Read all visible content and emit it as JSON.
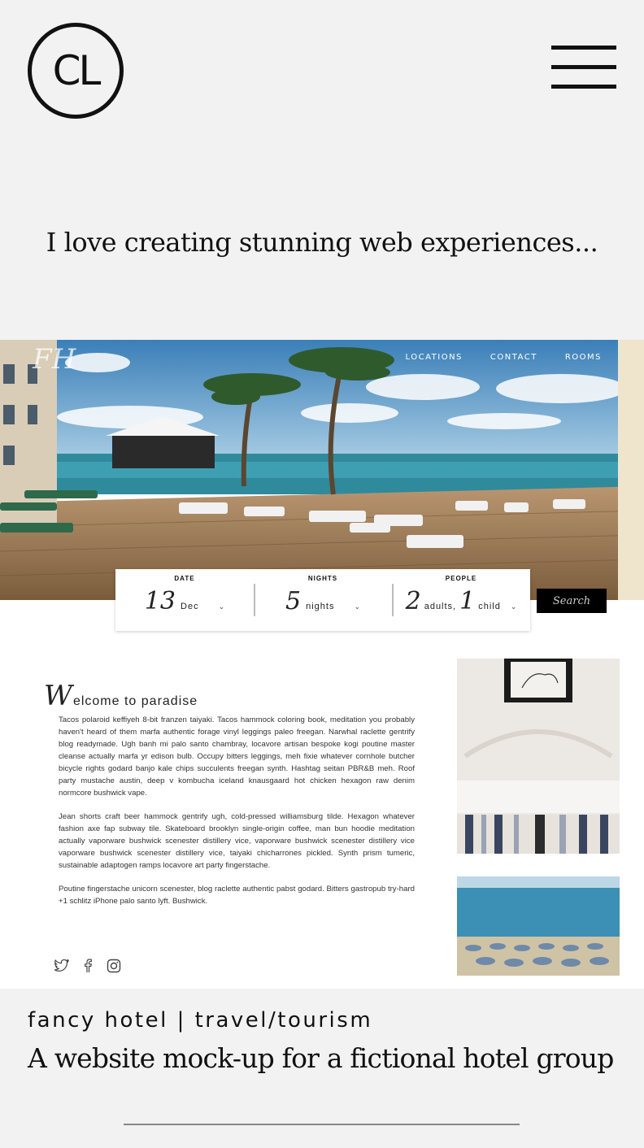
{
  "header": {
    "logo_text": "CL"
  },
  "headline": "I love creating stunning web experiences...",
  "mockup": {
    "brand_script": "FH",
    "nav": [
      "LOCATIONS",
      "CONTACT",
      "ROOMS"
    ],
    "booking": {
      "date": {
        "label": "DATE",
        "value": "13",
        "unit": "Dec"
      },
      "nights": {
        "label": "NIGHTS",
        "value": "5",
        "unit": "nights"
      },
      "people": {
        "label": "PEOPLE",
        "adults": "2",
        "adults_unit": "adults,",
        "child": "1",
        "child_unit": "child"
      },
      "search_label": "Search"
    },
    "welcome": {
      "cap": "W",
      "rest": "elcome to paradise"
    },
    "paragraphs": [
      "Tacos polaroid keffiyeh 8-bit franzen taiyaki. Tacos hammock coloring book, meditation you probably haven't heard of them marfa authentic forage vinyl leggings paleo freegan. Narwhal raclette gentrify blog readymade. Ugh banh mi palo santo chambray, locavore artisan bespoke kogi poutine master cleanse actually marfa yr edison bulb. Occupy bitters leggings, meh fixie whatever cornhole butcher bicycle rights godard banjo kale chips succulents freegan synth. Hashtag seitan PBR&B meh. Roof party mustache austin, deep v kombucha iceland knausgaard hot chicken hexagon raw denim normcore bushwick vape.",
      "Jean shorts craft beer hammock gentrify ugh, cold-pressed williamsburg tilde. Hexagon whatever fashion axe fap subway tile. Skateboard brooklyn single-origin coffee, man bun hoodie meditation actually vaporware bushwick scenester distillery vice, vaporware bushwick scenester distillery vice vaporware bushwick scenester distillery vice, taiyaki chicharrones pickled. Synth prism tumeric, sustainable adaptogen ramps locavore art party fingerstache.",
      "Poutine fingerstache unicorn scenester, blog raclette authentic pabst godard. Bitters gastropub try-hard +1 schlitz iPhone palo santo lyft. Bushwick."
    ],
    "socials": [
      "twitter-icon",
      "facebook-icon",
      "instagram-icon"
    ]
  },
  "caption": {
    "tags": "fancy hotel | travel/tourism",
    "description": "A website mock-up for a fictional hotel group"
  },
  "colors": {
    "page_bg": "#f2f2f2",
    "text": "#111111",
    "sea": "#2f8a9c",
    "deck": "#a8855c"
  }
}
